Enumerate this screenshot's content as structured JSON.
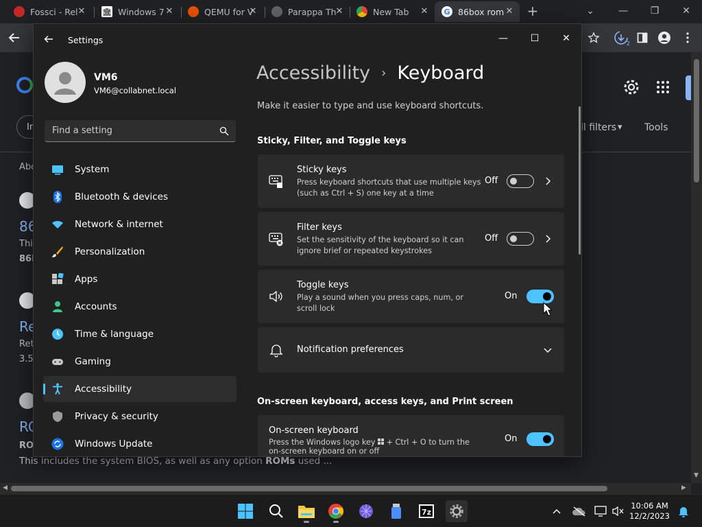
{
  "browser": {
    "tabs": [
      {
        "title": "Fossci - Rel"
      },
      {
        "title": "Windows 7"
      },
      {
        "title": "QEMU for V"
      },
      {
        "title": "Parappa Th"
      },
      {
        "title": "New Tab"
      },
      {
        "title": "86box rom"
      }
    ]
  },
  "background_page": {
    "filters_label": "ll filters",
    "tools_label": "Tools",
    "about_label": "Abo",
    "input_prefix": "In",
    "result1_title": "86",
    "result1_line1": "Thi",
    "result1_line2": "86E",
    "result2_title": "Re",
    "result2_line1": "Ret",
    "result2_line2": "3.5",
    "result3_title": "RC",
    "result3_line1": "RO",
    "snippet_a": "This includes the system BIOS, as well as any option ",
    "snippet_bold": "ROMs",
    "snippet_b": " used ..."
  },
  "settings": {
    "window_title": "Settings",
    "user": {
      "name": "VM6",
      "email": "VM6@collabnet.local"
    },
    "search": {
      "placeholder": "Find a setting"
    },
    "nav": [
      {
        "label": "System",
        "icon": "monitor-icon"
      },
      {
        "label": "Bluetooth & devices",
        "icon": "bluetooth-icon"
      },
      {
        "label": "Network & internet",
        "icon": "wifi-icon"
      },
      {
        "label": "Personalization",
        "icon": "brush-icon"
      },
      {
        "label": "Apps",
        "icon": "apps-icon"
      },
      {
        "label": "Accounts",
        "icon": "person-icon"
      },
      {
        "label": "Time & language",
        "icon": "globe-clock-icon"
      },
      {
        "label": "Gaming",
        "icon": "gamepad-icon"
      },
      {
        "label": "Accessibility",
        "icon": "accessibility-icon",
        "selected": true
      },
      {
        "label": "Privacy & security",
        "icon": "shield-icon"
      },
      {
        "label": "Windows Update",
        "icon": "update-icon"
      }
    ],
    "breadcrumb": {
      "parent": "Accessibility",
      "separator": "›",
      "current": "Keyboard"
    },
    "subtitle": "Make it easier to type and use keyboard shortcuts.",
    "section1": "Sticky, Filter, and Toggle keys",
    "sticky": {
      "title": "Sticky keys",
      "desc": "Press keyboard shortcuts that use multiple keys (such as Ctrl + S) one key at a time",
      "state": "Off"
    },
    "filter": {
      "title": "Filter keys",
      "desc": "Set the sensitivity of the keyboard so it can ignore brief or repeated keystrokes",
      "state": "Off"
    },
    "toggle": {
      "title": "Toggle keys",
      "desc": "Play a sound when you press caps, num, or scroll lock",
      "state": "On"
    },
    "notification": {
      "title": "Notification preferences"
    },
    "section2": "On-screen keyboard, access keys, and Print screen",
    "osk": {
      "title": "On-screen keyboard",
      "desc_a": "Press the Windows logo key ",
      "desc_b": " + Ctrl + O to turn the on-screen keyboard on or off",
      "state": "On"
    }
  },
  "taskbar": {
    "time": "10:06 AM",
    "date": "12/2/2023",
    "badge": "2"
  },
  "colors": {
    "accent": "#4cc2ff",
    "window_bg": "#202020",
    "card_bg": "#2b2b2b"
  }
}
